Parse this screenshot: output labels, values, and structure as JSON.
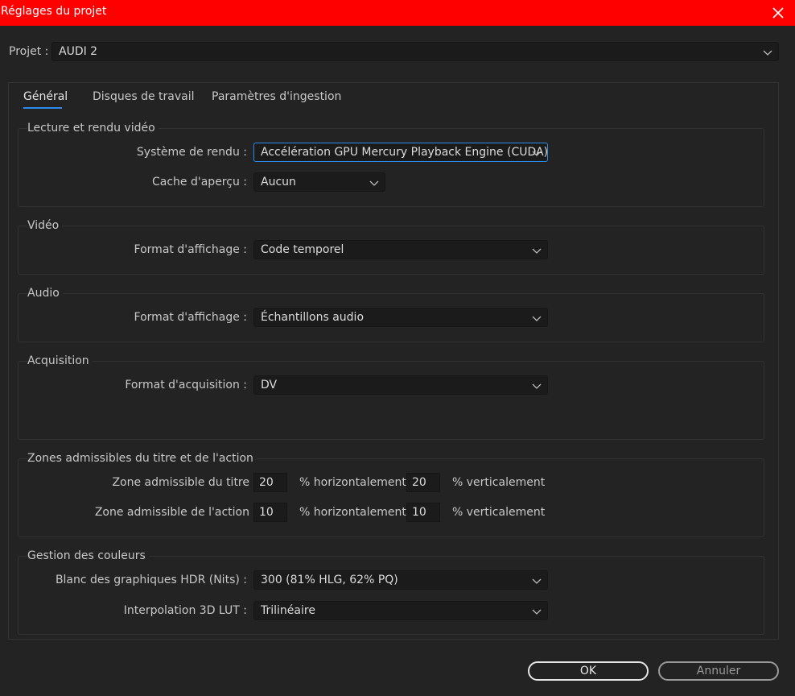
{
  "window": {
    "title": "Réglages du projet"
  },
  "project": {
    "label": "Projet :",
    "value": "AUDI 2"
  },
  "tabs": [
    {
      "label": "Général"
    },
    {
      "label": "Disques de travail"
    },
    {
      "label": "Paramètres d'ingestion"
    }
  ],
  "playback": {
    "title": "Lecture et rendu vidéo",
    "renderer_label": "Système de rendu :",
    "renderer_value": "Accélération GPU Mercury Playback Engine (CUDA)",
    "cache_label": "Cache d'aperçu :",
    "cache_value": "Aucun"
  },
  "video": {
    "title": "Vidéo",
    "format_label": "Format d'affichage :",
    "format_value": "Code temporel"
  },
  "audio": {
    "title": "Audio",
    "format_label": "Format d'affichage :",
    "format_value": "Échantillons audio"
  },
  "capture": {
    "title": "Acquisition",
    "format_label": "Format d'acquisition :",
    "format_value": "DV"
  },
  "safe_zones": {
    "title": "Zones admissibles du titre et de l'action",
    "title_safe_label": "Zone admissible du titre",
    "title_h": "20",
    "title_v": "20",
    "action_safe_label": "Zone admissible de l'action",
    "action_h": "10",
    "action_v": "10",
    "horiz_label": "% horizontalement",
    "vert_label": "% verticalement"
  },
  "color": {
    "title": "Gestion des couleurs",
    "hdr_label": "Blanc des graphiques HDR (Nits) :",
    "hdr_value": "300 (81% HLG, 62% PQ)",
    "lut_label": "Interpolation 3D LUT :",
    "lut_value": "Trilinéaire"
  },
  "buttons": {
    "ok": "OK",
    "cancel": "Annuler"
  },
  "colors": {
    "titlebar": "#ff0000",
    "accent": "#2d8ceb",
    "background": "#232323"
  }
}
